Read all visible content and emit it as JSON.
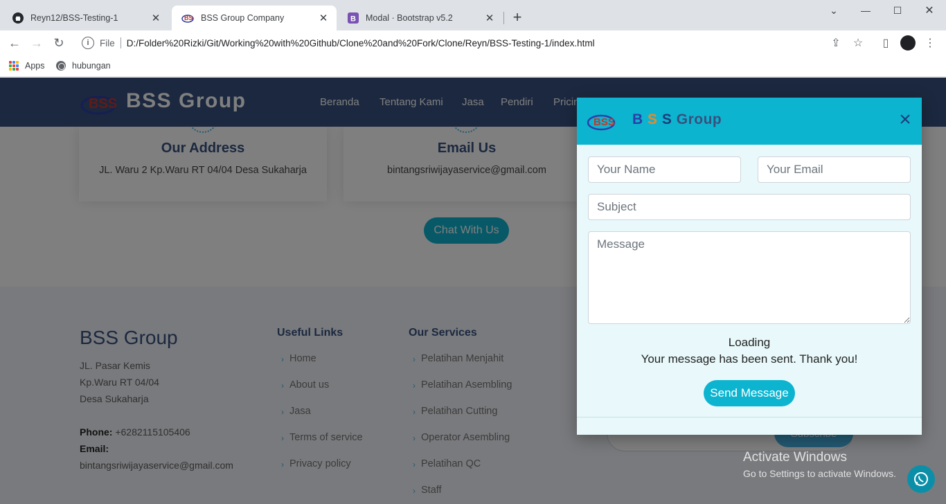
{
  "browser": {
    "tabs": [
      {
        "title": "Reyn12/BSS-Testing-1",
        "icon": "github-icon"
      },
      {
        "title": "BSS Group Company",
        "icon": "bss-favicon-icon"
      },
      {
        "title": "Modal · Bootstrap v5.2",
        "icon": "bootstrap-icon"
      }
    ],
    "new_tab": "+",
    "scheme": "File",
    "url": "D:/Folder%20Rizki/Git/Working%20with%20Github/Clone%20and%20Fork/Clone/Reyn/BSS-Testing-1/index.html",
    "bookmarks": [
      "Apps",
      "hubungan"
    ]
  },
  "site": {
    "logo_text": "BSS Group",
    "nav": [
      "Beranda",
      "Tentang Kami",
      "Jasa",
      "Pendiri",
      "Pricin"
    ],
    "address": {
      "title": "Our Address",
      "text": "JL. Waru 2 Kp.Waru RT 04/04 Desa Sukaharja"
    },
    "email": {
      "title": "Email Us",
      "text": "bintangsriwijayaservice@gmail.com"
    },
    "chat_button": "Chat With Us"
  },
  "footer": {
    "brand": "BSS Group",
    "address_lines": [
      "JL. Pasar Kemis",
      "Kp.Waru RT 04/04",
      "Desa Sukaharja"
    ],
    "phone_label": "Phone:",
    "phone": "+6282115105406",
    "email_label": "Email:",
    "email": "bintangsriwijayaservice@gmail.com",
    "useful_links_title": "Useful Links",
    "useful_links": [
      "Home",
      "About us",
      "Jasa",
      "Terms of service",
      "Privacy policy"
    ],
    "services_title": "Our Services",
    "services": [
      "Pelatihan Menjahit",
      "Pelatihan Asembling",
      "Pelatihan Cutting",
      "Operator Asembling",
      "Pelatihan QC",
      "Staff"
    ],
    "subscribe_label": "Subscribe"
  },
  "modal": {
    "title_b": "B",
    "title_s1": "S",
    "title_s2": "S",
    "title_rest": "Group",
    "name_placeholder": "Your Name",
    "email_placeholder": "Your Email",
    "subject_placeholder": "Subject",
    "message_placeholder": "Message",
    "loading": "Loading",
    "sent": "Your message has been sent. Thank you!",
    "send_button": "Send Message"
  },
  "overlay": {
    "activate_title": "Activate Windows",
    "activate_sub": "Go to Settings to activate Windows."
  },
  "colors": {
    "accent": "#0db4d0",
    "header": "#37517e",
    "link": "#47b2e4"
  }
}
